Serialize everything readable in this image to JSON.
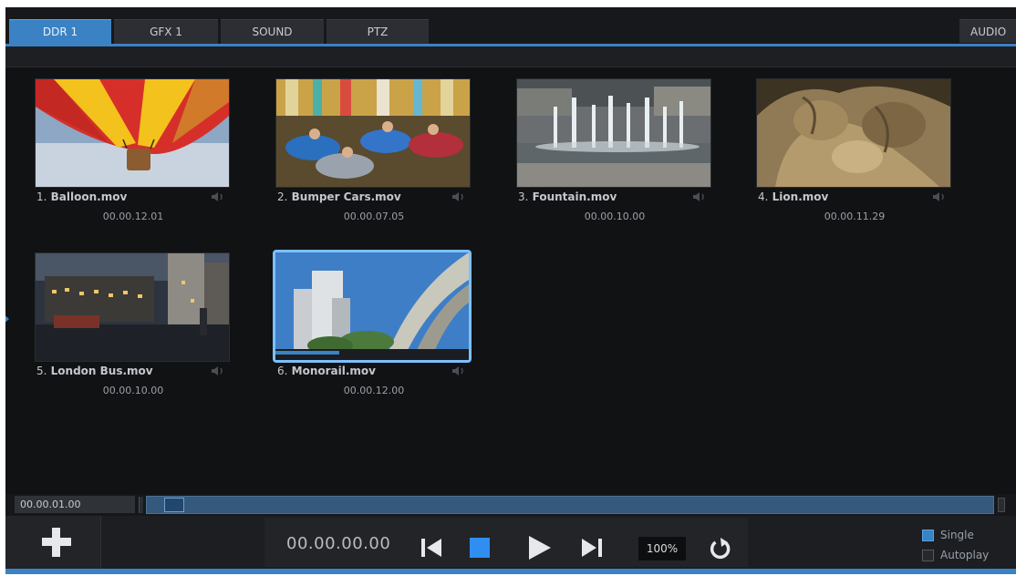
{
  "tabs": [
    {
      "label": "DDR 1",
      "active": true
    },
    {
      "label": "GFX 1",
      "active": false
    },
    {
      "label": "SOUND",
      "active": false
    },
    {
      "label": "PTZ",
      "active": false
    },
    {
      "label": "AUDIO",
      "active": false
    }
  ],
  "clips": [
    {
      "index": "1.",
      "name": "Balloon.mov",
      "duration": "00.00.12.01",
      "thumbnail": "hot-air-balloon"
    },
    {
      "index": "2.",
      "name": "Bumper Cars.mov",
      "duration": "00.00.07.05",
      "thumbnail": "bumper-cars"
    },
    {
      "index": "3.",
      "name": "Fountain.mov",
      "duration": "00.00.10.00",
      "thumbnail": "fountain"
    },
    {
      "index": "4.",
      "name": "Lion.mov",
      "duration": "00.00.11.29",
      "thumbnail": "lion-statue"
    },
    {
      "index": "5.",
      "name": "London Bus.mov",
      "duration": "00.00.10.00",
      "thumbnail": "night-street"
    },
    {
      "index": "6.",
      "name": "Monorail.mov",
      "duration": "00.00.12.00",
      "thumbnail": "monorail",
      "selected": true,
      "progress": 0.33
    }
  ],
  "scrub": {
    "time": "00.00.01.00",
    "position": 0.01
  },
  "transport": {
    "timecode": "00.00.00.00",
    "zoom": "100%",
    "buttons": [
      "skip-to-start-icon",
      "stop-icon",
      "play-icon",
      "skip-to-end-icon",
      "loop-icon"
    ]
  },
  "options": {
    "single": {
      "label": "Single",
      "checked": true
    },
    "autoplay": {
      "label": "Autoplay",
      "checked": false
    }
  },
  "colors": {
    "accent": "#3b82c4",
    "selection": "#7cc0ff",
    "background": "#111214"
  }
}
